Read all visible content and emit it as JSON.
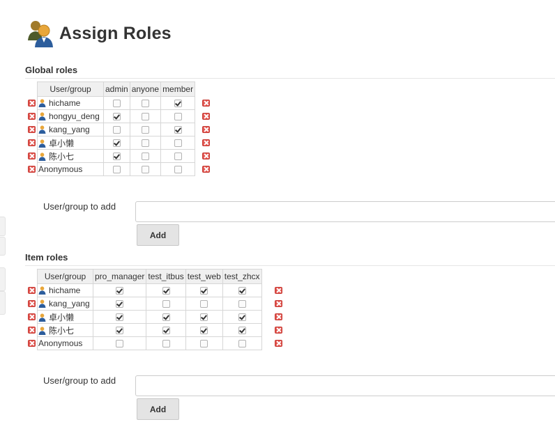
{
  "page": {
    "title": "Assign Roles",
    "icon": "assign-roles-icon"
  },
  "global_roles": {
    "title": "Global roles",
    "header": {
      "user_group": "User/group",
      "roles": [
        "admin",
        "anyone",
        "member"
      ]
    },
    "rows": [
      {
        "name": "hichame",
        "is_user": true,
        "checked": [
          false,
          false,
          true
        ]
      },
      {
        "name": "hongyu_deng",
        "is_user": true,
        "checked": [
          true,
          false,
          false
        ]
      },
      {
        "name": "kang_yang",
        "is_user": true,
        "checked": [
          false,
          false,
          true
        ]
      },
      {
        "name": "卓小懒",
        "is_user": true,
        "checked": [
          true,
          false,
          false
        ]
      },
      {
        "name": "陈小七",
        "is_user": true,
        "checked": [
          true,
          false,
          false
        ]
      },
      {
        "name": "Anonymous",
        "is_user": false,
        "checked": [
          false,
          false,
          false
        ]
      }
    ],
    "add_label": "User/group to add",
    "add_value": "",
    "add_button": "Add"
  },
  "item_roles": {
    "title": "Item roles",
    "header": {
      "user_group": "User/group",
      "roles": [
        "pro_manager",
        "test_itbus",
        "test_web",
        "test_zhcx"
      ]
    },
    "rows": [
      {
        "name": "hichame",
        "is_user": true,
        "checked": [
          true,
          true,
          true,
          true
        ]
      },
      {
        "name": "kang_yang",
        "is_user": true,
        "checked": [
          true,
          false,
          false,
          false
        ]
      },
      {
        "name": "卓小懒",
        "is_user": true,
        "checked": [
          true,
          true,
          true,
          true
        ]
      },
      {
        "name": "陈小七",
        "is_user": true,
        "checked": [
          true,
          true,
          true,
          true
        ]
      },
      {
        "name": "Anonymous",
        "is_user": false,
        "checked": [
          false,
          false,
          false,
          false
        ]
      }
    ],
    "add_label": "User/group to add",
    "add_value": "",
    "add_button": "Add"
  },
  "colors": {
    "delete": "#e2554f",
    "header_bg": "#f0f0f0",
    "border": "#d6d6d6",
    "button_bg": "#e4e4e4"
  }
}
